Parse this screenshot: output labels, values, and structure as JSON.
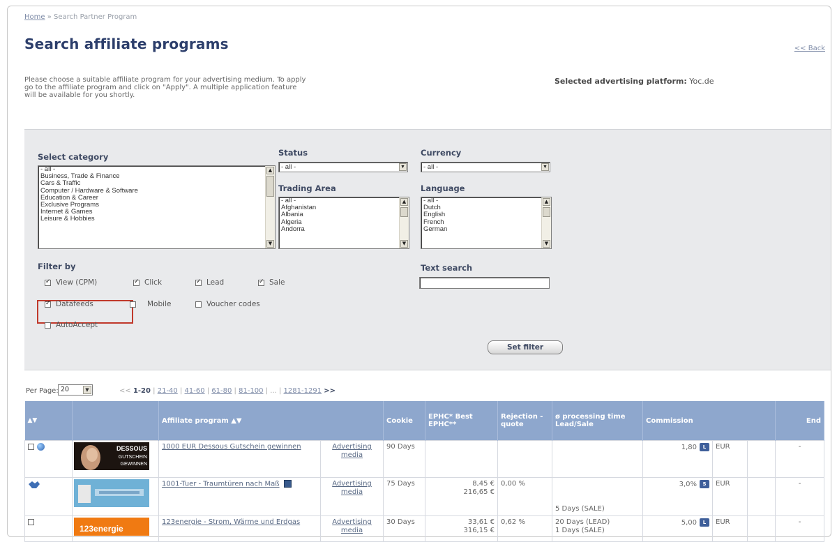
{
  "breadcrumb": {
    "home": "Home",
    "separator": "»",
    "current": "Search Partner Program"
  },
  "page": {
    "title": "Search affiliate programs",
    "back_label": "<< Back",
    "intro": "Please choose a suitable affiliate program for your advertising medium. To apply go to the affiliate program and click on \"Apply\". A multiple application feature will be available for you shortly.",
    "platform_label": "Selected advertising platform:",
    "platform_value": "Yoc.de"
  },
  "filters": {
    "category_label": "Select category",
    "category_options": [
      "- all -",
      "Business, Trade & Finance",
      "Cars & Traffic",
      "Computer / Hardware & Software",
      "Education & Career",
      "Exclusive Programs",
      "Internet & Games",
      "Leisure & Hobbies"
    ],
    "status_label": "Status",
    "status_value": "- all -",
    "currency_label": "Currency",
    "currency_value": "- all -",
    "trading_label": "Trading Area",
    "trading_options": [
      "- all -",
      "Afghanistan",
      "Albania",
      "Algeria",
      "Andorra"
    ],
    "language_label": "Language",
    "language_options": [
      "- all -",
      "Dutch",
      "English",
      "French",
      "German"
    ],
    "filter_by_label": "Filter by",
    "checkboxes": [
      {
        "label": "View (CPM)",
        "checked": true
      },
      {
        "label": "Click",
        "checked": true
      },
      {
        "label": "Lead",
        "checked": true
      },
      {
        "label": "Sale",
        "checked": true
      },
      {
        "label": "Datafeeds",
        "checked": true
      },
      {
        "label": "Mobile",
        "checked": false
      },
      {
        "label": "Voucher codes",
        "checked": false
      },
      {
        "label": "AutoAccept",
        "checked": false
      }
    ],
    "text_search_label": "Text search",
    "text_search_value": "",
    "set_filter_label": "Set filter"
  },
  "pagination": {
    "per_page_label": "Per Page:",
    "per_page_value": "20",
    "prev": "<<",
    "current": "1-20",
    "pages": [
      "21-40",
      "41-60",
      "61-80",
      "81-100",
      "...",
      "1281-1291"
    ],
    "next": ">>"
  },
  "table": {
    "headers": {
      "select": "▲▼",
      "program": "Affiliate program ▲▼",
      "cookie": "Cookie",
      "epc": "EPHC* Best EPHC**",
      "rejection": "Rejection - quote",
      "processing": "ø processing time Lead/Sale",
      "commission": "Commission",
      "end": "End"
    },
    "rows": [
      {
        "banner": "DESSOUS GUTSCHEIN GEWINNEN",
        "name": "1000 EUR Dessous Gutschein gewinnen",
        "media": "Advertising media",
        "cookie": "90 Days",
        "epc": "",
        "best_epc": "",
        "rejection": "",
        "processing": "",
        "commission": "1,80",
        "comm_icon": "L",
        "currency": "EUR",
        "end": "-"
      },
      {
        "banner": "",
        "name": "1001-Tuer - Traumtüren nach Maß",
        "media": "Advertising media",
        "cookie": "75 Days",
        "epc": "8,45 €",
        "best_epc": "216,65 €",
        "rejection": "0,00 %",
        "processing": "5 Days (SALE)",
        "commission": "3,0%",
        "comm_icon": "S",
        "currency": "EUR",
        "end": "-"
      },
      {
        "banner": "123energie",
        "name": "123energie - Strom, Wärme und Erdgas",
        "media": "Advertising media",
        "cookie": "30 Days",
        "epc": "33,61 €",
        "best_epc": "316,15 €",
        "rejection": "0,62 %",
        "processing": "20 Days (LEAD)",
        "processing2": "1 Days (SALE)",
        "commission": "5,00",
        "comm_icon": "L",
        "currency": "EUR",
        "end": "-"
      }
    ]
  }
}
